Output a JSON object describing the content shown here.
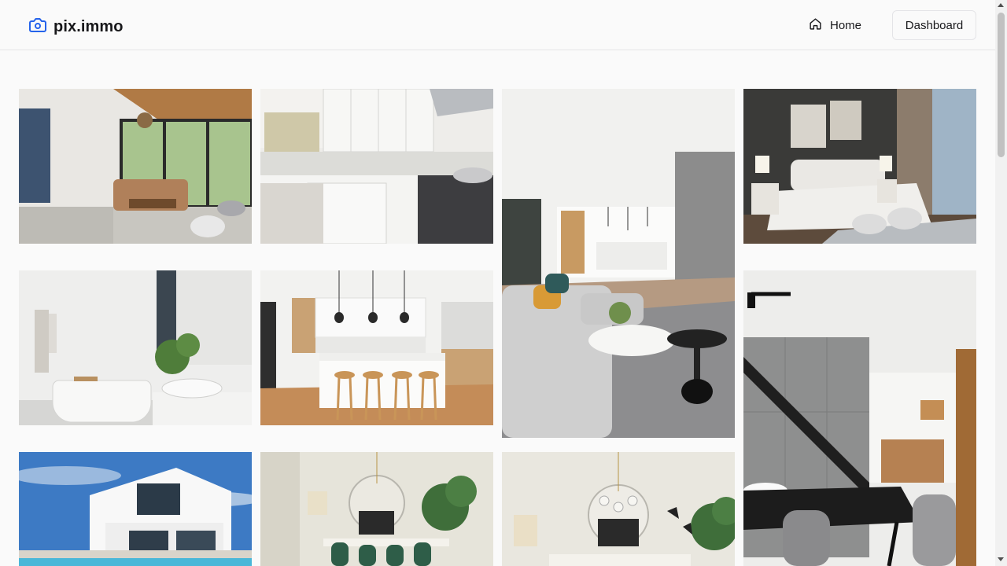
{
  "header": {
    "brand": "pix.immo",
    "brand_icon": "camera-icon",
    "nav_home_label": "Home",
    "nav_home_icon": "home-icon",
    "dashboard_label": "Dashboard"
  },
  "colors": {
    "accent": "#2563eb",
    "background": "#fafafa",
    "border": "#e4e4e7",
    "text": "#18181b"
  },
  "gallery": {
    "photos": [
      {
        "subject": "living room with large windows"
      },
      {
        "subject": "white kitchen with range hood"
      },
      {
        "subject": "open living room and kitchen"
      },
      {
        "subject": "bedroom with dark walls"
      },
      {
        "subject": "bathroom with freestanding tub"
      },
      {
        "subject": "kitchen island with bar stools"
      },
      {
        "subject": "staircase and dining area"
      },
      {
        "subject": "modern white villa with pool"
      },
      {
        "subject": "dining room with green chairs"
      },
      {
        "subject": "dining room with round mirror"
      }
    ]
  }
}
